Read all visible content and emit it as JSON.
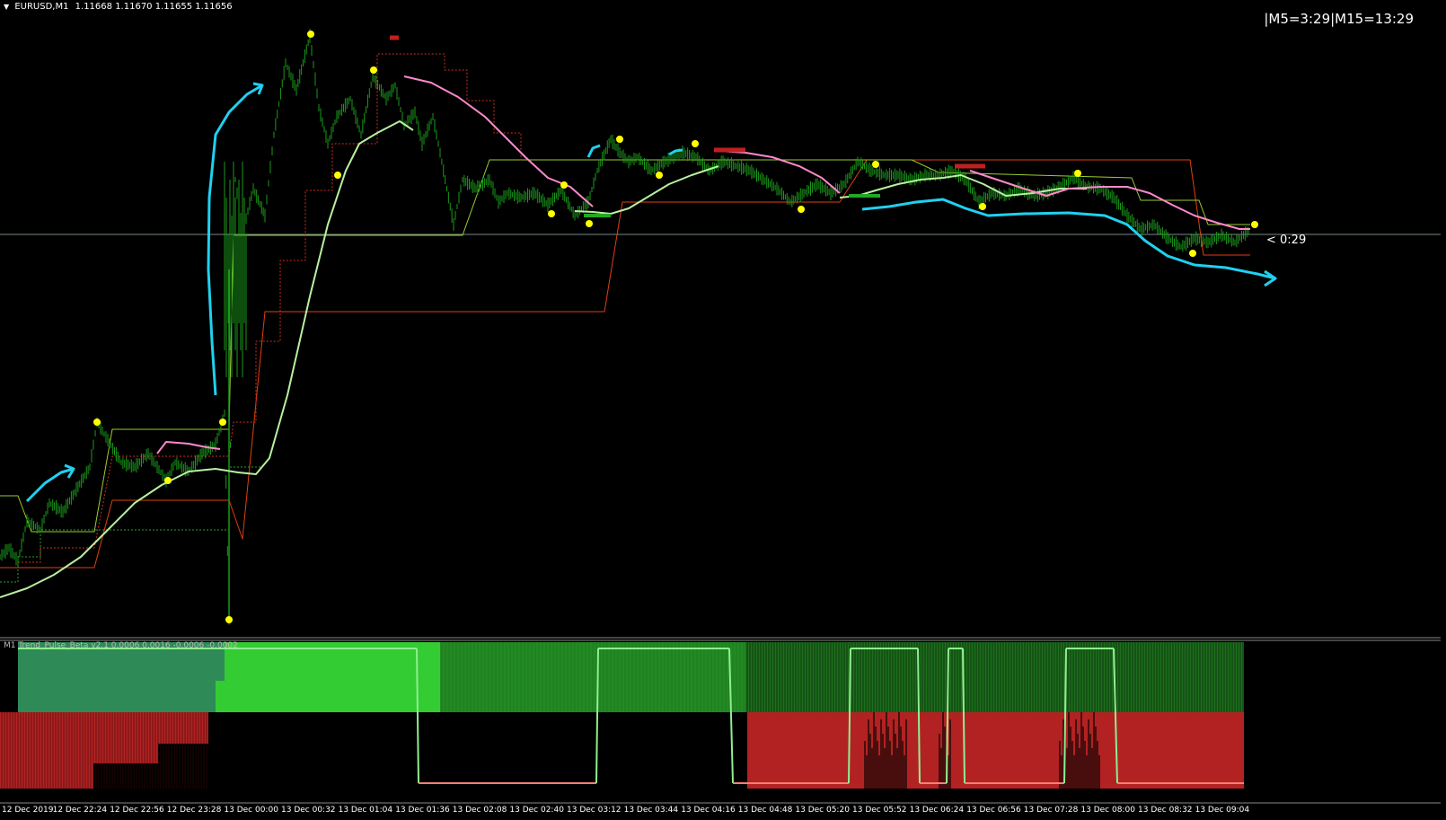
{
  "header": {
    "symbol": "EURUSD,M1",
    "prices": "1.11668 1.11670 1.11655 1.11656"
  },
  "timer_top": "|M5=3:29|M15=13:29",
  "bar_timer": "< 0:29",
  "indicator": {
    "label": "M1 Trend_Pulse_Beta v2.1 0.0006 0.0016 -0.0006 -0.0002"
  },
  "time_axis": [
    "12 Dec 2019",
    "12 Dec 22:24",
    "12 Dec 22:56",
    "12 Dec 23:28",
    "13 Dec 00:00",
    "13 Dec 00:32",
    "13 Dec 01:04",
    "13 Dec 01:36",
    "13 Dec 02:08",
    "13 Dec 02:40",
    "13 Dec 03:12",
    "13 Dec 03:44",
    "13 Dec 04:16",
    "13 Dec 04:48",
    "13 Dec 05:20",
    "13 Dec 05:52",
    "13 Dec 06:24",
    "13 Dec 06:56",
    "13 Dec 07:28",
    "13 Dec 08:00",
    "13 Dec 08:32",
    "13 Dec 09:04"
  ],
  "colors": {
    "background": "#000000",
    "candles": "#1a9a1a",
    "fast_ma": "#b8f0a0",
    "slow_ma": "#ff88cc",
    "channel_upper": "#9acd32",
    "channel_lower": "#e04010",
    "signal_dot": "#ffff00",
    "arrow": "#20d0f0",
    "resistance_mark": "#c02020",
    "osc_green_bright": "#33cc33",
    "osc_green_dark": "#2e8b57",
    "osc_green_deep": "#1e6e1e",
    "osc_red": "#b22222",
    "osc_line_green": "#90ee90",
    "osc_line_salmon": "#fa8072"
  }
}
